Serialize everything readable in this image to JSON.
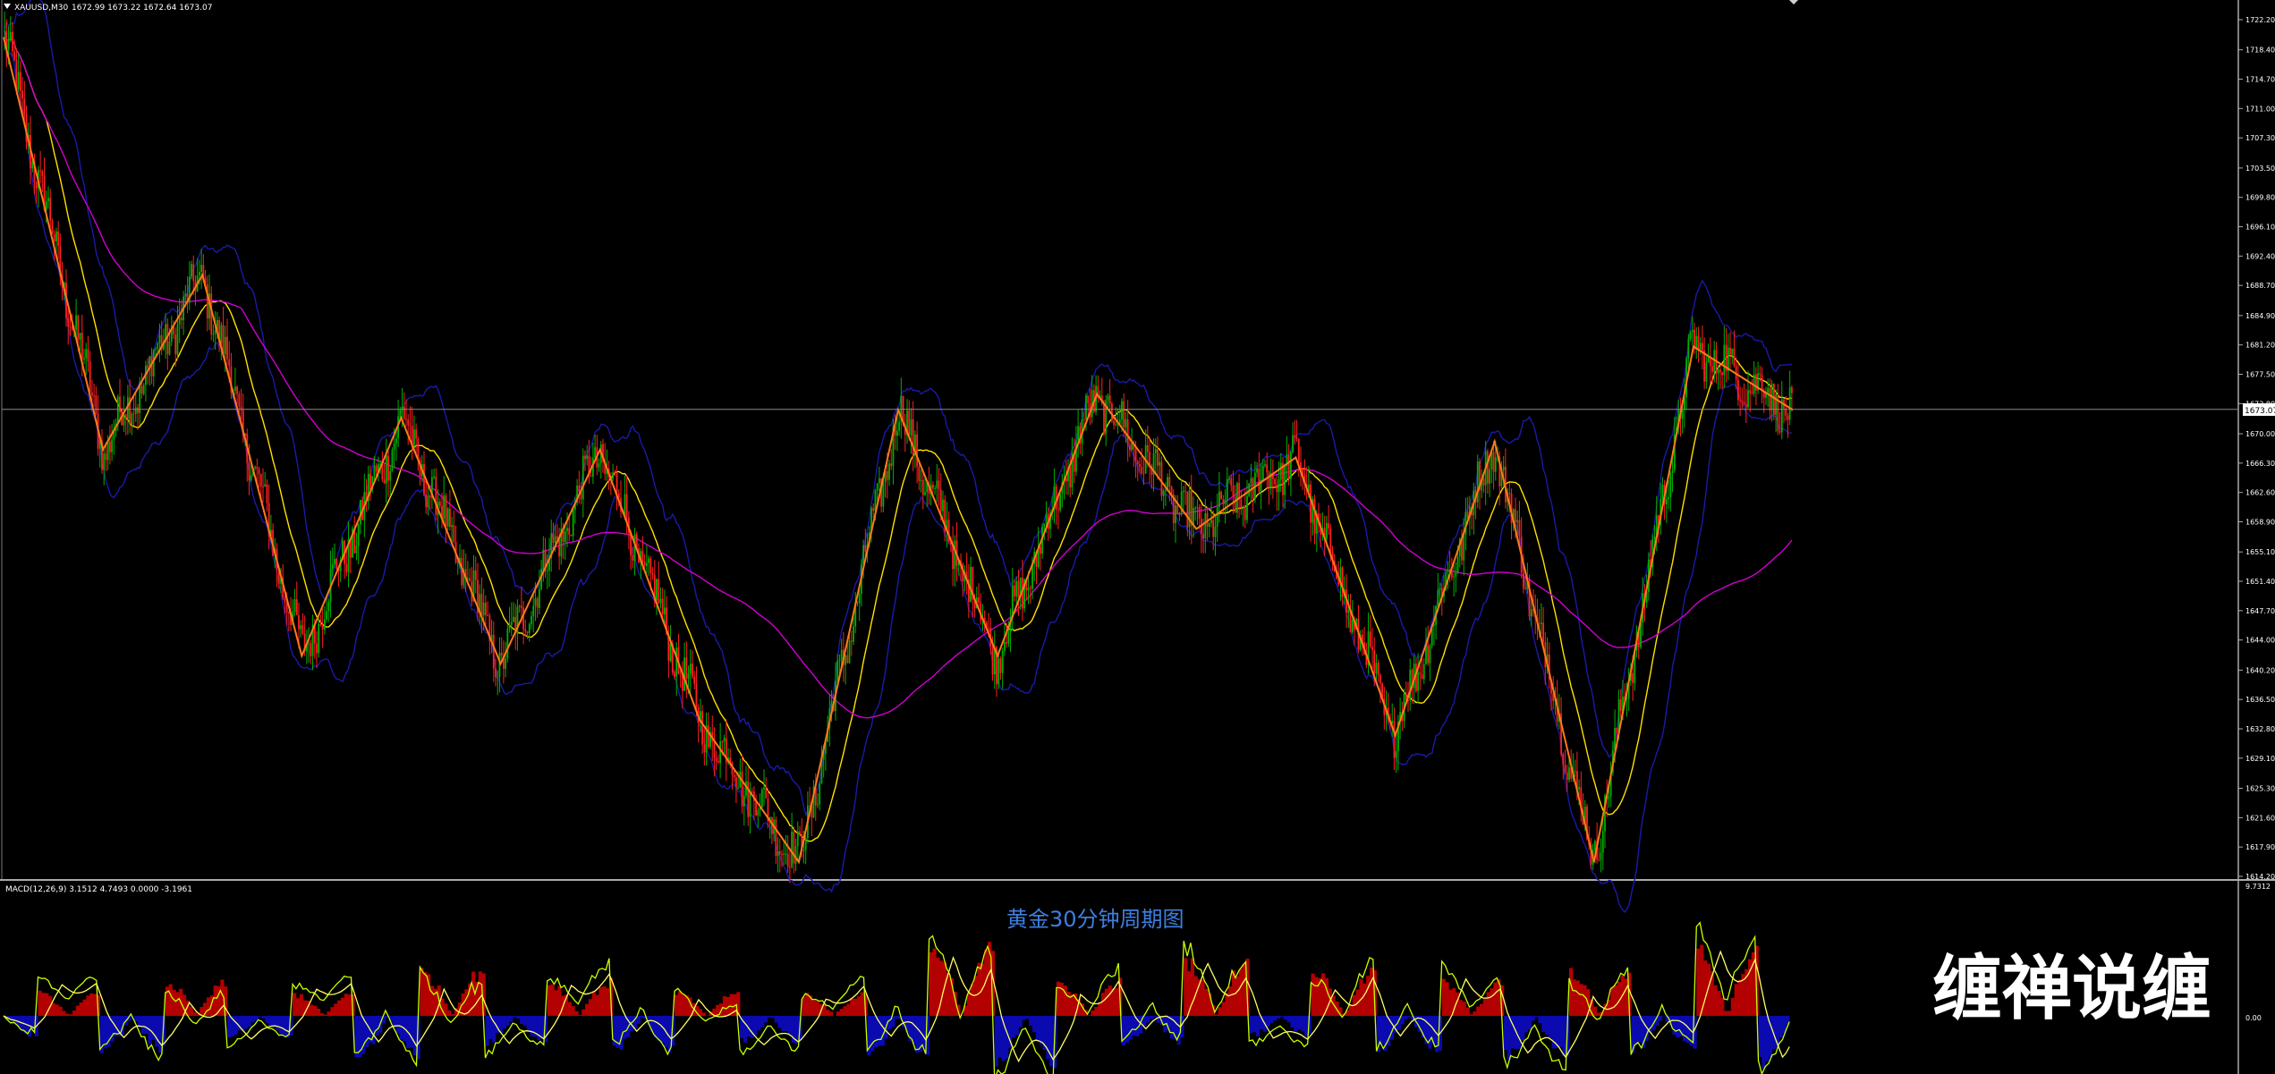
{
  "header": {
    "symbol": "XAUUSD,M30",
    "quote": "1672.99 1673.22 1672.64 1673.07"
  },
  "macd_header": {
    "label": "MACD(12,26,9) 3.1512 4.7493 0.0000 -3.1961"
  },
  "overlay": {
    "caption": "黄金30分钟周期图",
    "watermark": "缠禅说缠"
  },
  "colors": {
    "background": "#000000",
    "bull_candle": "#00b000",
    "bear_candle": "#ff2020",
    "zigzag": "#ff7a1a",
    "ma_fast": "#ffe000",
    "ma_slow": "#d000d0",
    "bollinger": "#1a1aa8",
    "macd_pos": "#b30000",
    "macd_neg": "#0a0ab0",
    "macd_line": "#c8ff00",
    "signal_line": "#ffff66",
    "caption": "#3d7fe0",
    "price_line": "#8a8a8a"
  },
  "chart_data": [
    {
      "type": "candlestick",
      "timeframe": "M30",
      "ylim": [
        1614.2,
        1722.2
      ],
      "y_ticks": [
        "1722.20",
        "1718.40",
        "1714.70",
        "1711.00",
        "1707.30",
        "1703.50",
        "1699.80",
        "1696.10",
        "1692.40",
        "1688.70",
        "1684.90",
        "1681.20",
        "1677.50",
        "1673.80",
        "1670.00",
        "1666.30",
        "1662.60",
        "1658.90",
        "1655.10",
        "1651.40",
        "1647.70",
        "1644.00",
        "1640.20",
        "1636.50",
        "1632.80",
        "1629.10",
        "1625.30",
        "1621.60",
        "1617.90",
        "1614.20"
      ],
      "current_price": 1673.07,
      "current_price_label": "1673.07",
      "zigzag_pivots": [
        1720,
        1668,
        1690,
        1642,
        1672,
        1641,
        1668,
        1634,
        1616,
        1673,
        1642,
        1675,
        1658,
        1667,
        1632,
        1669,
        1616,
        1681,
        1673
      ],
      "overlay_lines": [
        "zigzag",
        "ma_fast",
        "ma_slow",
        "bollinger_upper",
        "bollinger_lower"
      ]
    },
    {
      "type": "macd",
      "params": "12,26,9",
      "ylim": [
        -7.5,
        9.7312
      ],
      "y_ticks": [
        "9.7312",
        "0.00"
      ],
      "histogram_swings": [
        -3,
        2,
        -5,
        3,
        -3,
        2,
        -6,
        4,
        -4,
        3,
        -5,
        2,
        -4,
        2,
        -6,
        6,
        -7,
        3,
        -4,
        5,
        -3,
        4,
        -5,
        3,
        -6,
        4,
        -5,
        6,
        -7
      ]
    }
  ]
}
